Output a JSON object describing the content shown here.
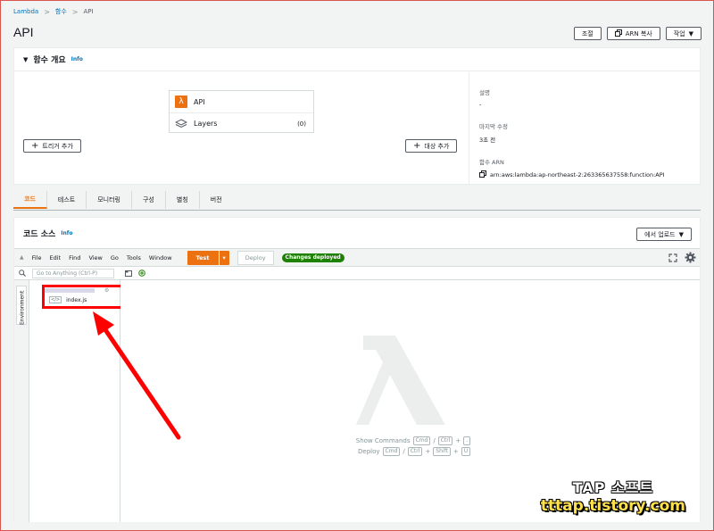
{
  "breadcrumb": {
    "items": [
      "Lambda",
      "함수",
      "API"
    ]
  },
  "page": {
    "title": "API"
  },
  "header_actions": {
    "throttle": "조절",
    "copy_arn": "ARN 복사",
    "actions": "작업"
  },
  "overview": {
    "title": "함수 개요",
    "info": "Info",
    "function_name": "API",
    "layers_label": "Layers",
    "layers_count": "(0)",
    "add_trigger": "트리거 추가",
    "add_destination": "대상 추가",
    "description_label": "설명",
    "description_value": "-",
    "last_modified_label": "마지막 수정",
    "last_modified_value": "3초 전",
    "arn_label": "함수 ARN",
    "arn_value": "arn:aws:lambda:ap-northeast-2:263365637558:function:API"
  },
  "tabs": [
    "코드",
    "테스트",
    "모니터링",
    "구성",
    "별칭",
    "버전"
  ],
  "code_source": {
    "title": "코드 소스",
    "info": "Info",
    "upload": "에서 업로드"
  },
  "ide": {
    "menu": [
      "File",
      "Edit",
      "Find",
      "View",
      "Go",
      "Tools",
      "Window"
    ],
    "test": "Test",
    "deploy": "Deploy",
    "deployed_badge": "Changes deployed",
    "goto_placeholder": "Go to Anything (Ctrl-P)",
    "env_tab": "Environment",
    "file": "index.js",
    "show_commands": "Show Commands",
    "show_commands_keys": [
      "Cmd",
      "Ctrl",
      "."
    ],
    "deploy_shortcut": "Deploy",
    "deploy_keys": [
      "Cmd",
      "Ctrl",
      "Shift",
      "U"
    ]
  },
  "watermark": {
    "top": "TAP 소프트",
    "bottom": "tttap.tistory.com"
  },
  "colors": {
    "accent": "#ec7211",
    "link": "#0073bb",
    "success": "#1d8102",
    "annotation": "#ff0000"
  }
}
